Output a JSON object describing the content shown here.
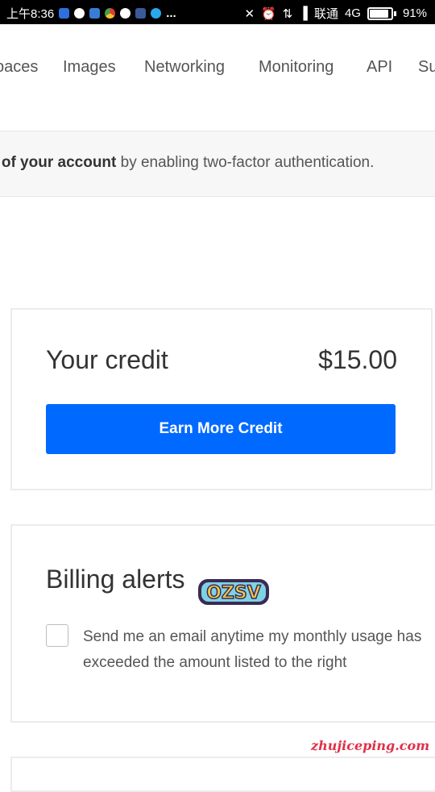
{
  "status_bar": {
    "time": "上午8:36",
    "more": "...",
    "carrier": "联通",
    "network": "4G",
    "battery": "91%"
  },
  "nav": {
    "items": [
      "paces",
      "Images",
      "Networking",
      "Monitoring",
      "API",
      "Su"
    ]
  },
  "banner": {
    "bold": "y of your account",
    "rest": " by enabling two-factor authentication."
  },
  "credit": {
    "label": "Your credit",
    "amount": "$15.00",
    "button": "Earn More Credit"
  },
  "billing": {
    "title": "Billing alerts",
    "description": "Send me an email anytime my monthly usage has exceeded the amount listed to the right",
    "checked": false
  },
  "watermarks": {
    "badge": "OZSV",
    "site": "zhujiceping.com"
  },
  "colors": {
    "primary_button": "#0069ff",
    "watermark": "#e0314a"
  }
}
